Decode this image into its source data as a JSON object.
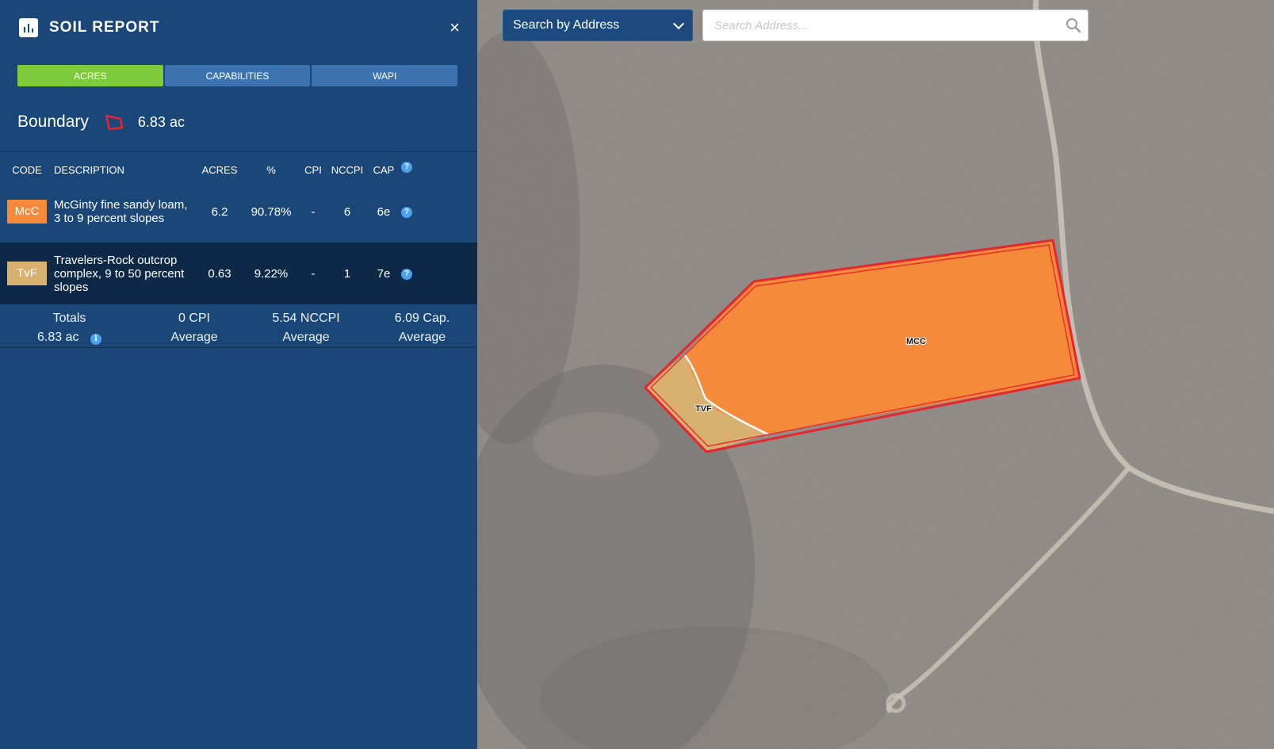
{
  "panel": {
    "title": "SOIL REPORT",
    "close_label": "×",
    "tabs": [
      {
        "label": "ACRES",
        "active": true
      },
      {
        "label": "CAPABILITIES",
        "active": false
      },
      {
        "label": "WAPI",
        "active": false
      }
    ],
    "boundary": {
      "label": "Boundary",
      "value": "6.83 ac",
      "color": "#e8242c"
    },
    "columns": [
      "CODE",
      "DESCRIPTION",
      "ACRES",
      "%",
      "CPI",
      "NCCPI",
      "CAP"
    ],
    "rows": [
      {
        "code": "McC",
        "color": "#f58a3a",
        "description": "McGinty fine sandy loam, 3 to 9 percent slopes",
        "acres": "6.2",
        "percent": "90.78%",
        "cpi": "-",
        "nccpi": "6",
        "cap": "6e"
      },
      {
        "code": "TvF",
        "color": "#d8b070",
        "description": "Travelers-Rock outcrop complex, 9 to 50 percent slopes",
        "acres": "0.63",
        "percent": "9.22%",
        "cpi": "-",
        "nccpi": "1",
        "cap": "7e"
      }
    ],
    "totals": {
      "label": "Totals",
      "acres": "6.83 ac",
      "cpi": "0 CPI",
      "cpi_sub": "Average",
      "nccpi": "5.54 NCCPI",
      "nccpi_sub": "Average",
      "cap": "6.09 Cap.",
      "cap_sub": "Average"
    }
  },
  "map": {
    "search_mode": "Search by Address",
    "search_placeholder": "Search Address...",
    "labels": {
      "mcc": "MCC",
      "tvf": "TVF"
    },
    "colors": {
      "mcc": "#f58a3a",
      "tvf": "#d8b070",
      "boundary": "#e8242c"
    }
  }
}
